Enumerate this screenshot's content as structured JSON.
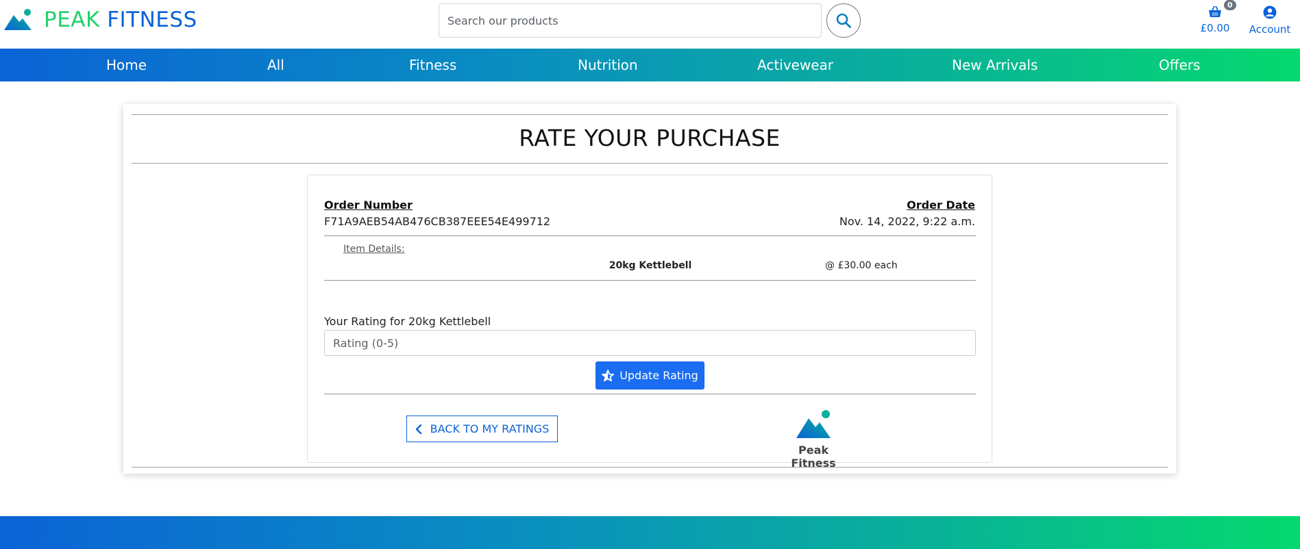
{
  "brand": {
    "word1": "PEAK",
    "word2": "FITNESS",
    "icon": "mountain-logo-icon"
  },
  "search": {
    "placeholder": "Search our products",
    "icon": "search-icon"
  },
  "basket": {
    "total": "£0.00",
    "count": "0",
    "icon": "basket-icon"
  },
  "account": {
    "label": "Account",
    "icon": "account-circle-icon"
  },
  "nav": {
    "items": [
      {
        "label": "Home"
      },
      {
        "label": "All"
      },
      {
        "label": "Fitness"
      },
      {
        "label": "Nutrition"
      },
      {
        "label": "Activewear"
      },
      {
        "label": "New Arrivals"
      },
      {
        "label": "Offers"
      }
    ]
  },
  "page": {
    "title": "RATE YOUR PURCHASE"
  },
  "order": {
    "number_label": "Order Number",
    "number": "F71A9AEB54AB476CB387EEE54E499712",
    "date_label": "Order Date",
    "date": "Nov. 14, 2022, 9:22 a.m."
  },
  "item": {
    "details_label": "Item Details:",
    "name": "20kg Kettlebell",
    "price": "@ £30.00 each"
  },
  "rating": {
    "label": "Your Rating for 20kg Kettlebell",
    "placeholder": "Rating (0-5)",
    "button": "Update Rating",
    "button_icon": "star-rating-icon"
  },
  "back": {
    "label": "BACK TO MY RATINGS",
    "icon": "chevron-left-icon"
  },
  "mini_logo": {
    "label": "Peak Fitness"
  },
  "colors": {
    "brand_blue": "#0b63d6",
    "brand_green": "#1fd26a",
    "button_blue": "#1a6df0"
  }
}
